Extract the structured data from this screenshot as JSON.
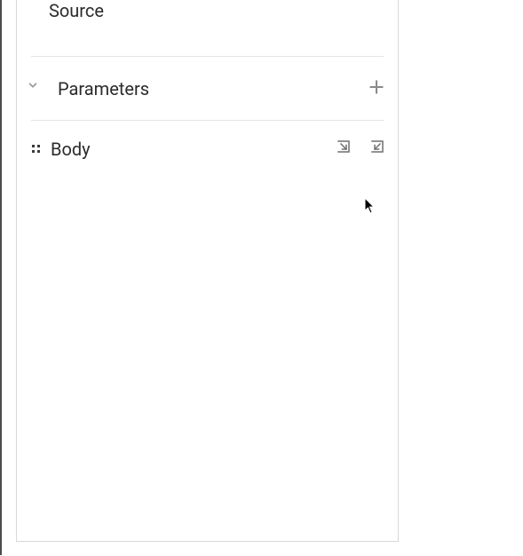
{
  "panel": {
    "source": {
      "label": "Source"
    },
    "parameters": {
      "label": "Parameters",
      "expanded": false,
      "icons": {
        "chevron": "chevron-down-icon",
        "add": "plus-icon"
      }
    },
    "body": {
      "label": "Body",
      "icons": {
        "drag": "drag-handle-icon",
        "import": "import-icon",
        "export": "export-icon"
      }
    }
  }
}
